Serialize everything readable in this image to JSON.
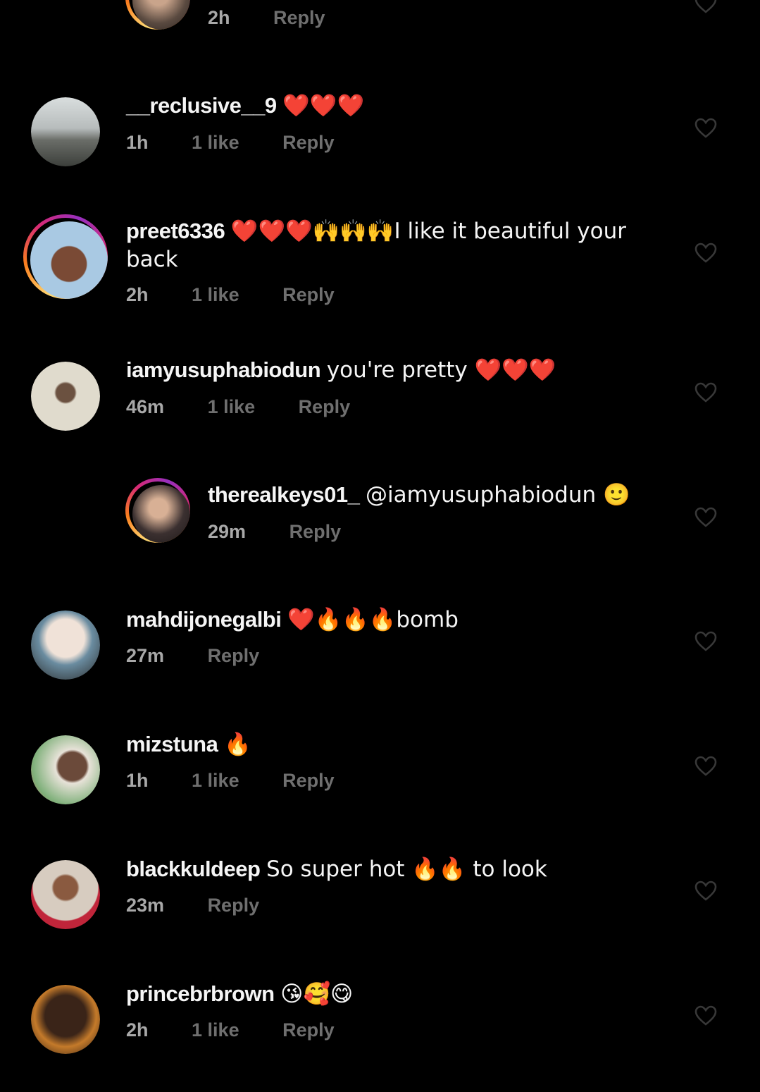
{
  "comments": [
    {
      "id": "c0",
      "username": "",
      "text": "",
      "time": "2h",
      "likes": "",
      "reply": "Reply",
      "level": "reply",
      "avatar_colors": [
        "#5a4a40",
        "#c9a48b"
      ]
    },
    {
      "id": "c1",
      "username": "__reclusive__9",
      "text": "❤️❤️❤️",
      "time": "1h",
      "likes": "1 like",
      "reply": "Reply",
      "level": "top",
      "avatar_colors": [
        "#cfd4d4",
        "#5c5f5c"
      ]
    },
    {
      "id": "c2",
      "username": "preet6336",
      "text": "❤️❤️❤️🙌🙌🙌I like it beautiful your back",
      "time": "2h",
      "likes": "1 like",
      "reply": "Reply",
      "level": "top",
      "avatar_colors": [
        "#a9c9e3",
        "#7a4a35"
      ]
    },
    {
      "id": "c3",
      "username": "iamyusuphabiodun",
      "text": "you're pretty ❤️❤️❤️",
      "time": "46m",
      "likes": "1 like",
      "reply": "Reply",
      "level": "top",
      "avatar_colors": [
        "#ddd8c8",
        "#6b5140"
      ]
    },
    {
      "id": "c4",
      "username": "therealkeys01_",
      "text": "@iamyusuphabiodun 🙂",
      "time": "29m",
      "likes": "",
      "reply": "Reply",
      "level": "reply",
      "avatar_colors": [
        "#3b3030",
        "#d8b095"
      ]
    },
    {
      "id": "c5",
      "username": "mahdijonegalbi",
      "text": "❤️🔥🔥🔥bomb",
      "time": "27m",
      "likes": "",
      "reply": "Reply",
      "level": "top",
      "avatar_colors": [
        "#e8d8cf",
        "#6a8ca0"
      ]
    },
    {
      "id": "c6",
      "username": "mizstuna",
      "text": "🔥",
      "time": "1h",
      "likes": "1 like",
      "reply": "Reply",
      "level": "top",
      "avatar_colors": [
        "#7fb07a",
        "#6b4a3a"
      ]
    },
    {
      "id": "c7",
      "username": "blackkuldeep",
      "text": "So super hot 🔥🔥 to look",
      "time": "23m",
      "likes": "",
      "reply": "Reply",
      "level": "top",
      "avatar_colors": [
        "#d7ccc0",
        "#c0253a"
      ]
    },
    {
      "id": "c8",
      "username": "princebrbrown",
      "text": "😘🥰😋",
      "time": "2h",
      "likes": "1 like",
      "reply": "Reply",
      "level": "top",
      "avatar_colors": [
        "#c47a2a",
        "#3a2418"
      ]
    }
  ]
}
